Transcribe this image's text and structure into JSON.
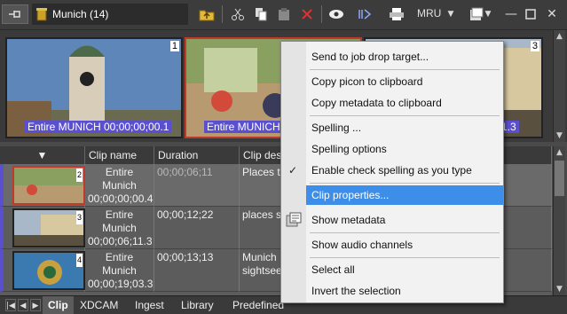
{
  "toolbar": {
    "bin_title": "Munich (14)",
    "mru_label": "MRU"
  },
  "picons": [
    {
      "caption": "Entire MUNICH 00;00;00;00.1",
      "number": "1"
    },
    {
      "caption": "Entire MUNICH",
      "number": "2"
    },
    {
      "caption": "1.3",
      "number": "3"
    }
  ],
  "grid": {
    "headers": [
      "",
      "Clip name",
      "Duration",
      "Clip des"
    ],
    "rows": [
      {
        "num": "2",
        "name": "Entire Munich",
        "tc": "00;00;00;00.4",
        "duration": "00;00;06;11",
        "desc": "Places to"
      },
      {
        "num": "3",
        "name": "Entire Munich",
        "tc": "00;00;06;11.3",
        "duration": "00;00;12;22",
        "desc": "places si"
      },
      {
        "num": "4",
        "name": "Entire Munich",
        "tc": "00;00;19;03.3",
        "duration": "00;00;13;13",
        "desc": "Munich",
        "desc2": "sightsee"
      }
    ]
  },
  "tabs": [
    "Clip",
    "XDCAM",
    "Ingest",
    "Library",
    "Predefined"
  ],
  "context_menu": {
    "items": [
      "Send to job drop target...",
      "Copy picon to clipboard",
      "Copy metadata to clipboard",
      "Spelling ...",
      "Spelling options",
      "Enable check spelling as you type",
      "Clip properties...",
      "Show metadata",
      "Show audio channels",
      "Select all",
      "Invert the selection"
    ],
    "check_mark": "✓"
  },
  "colors": {
    "menu_highlight": "#3d8ee8",
    "selection_border": "#c0392b",
    "caption_bg": "#5a4fcf"
  }
}
